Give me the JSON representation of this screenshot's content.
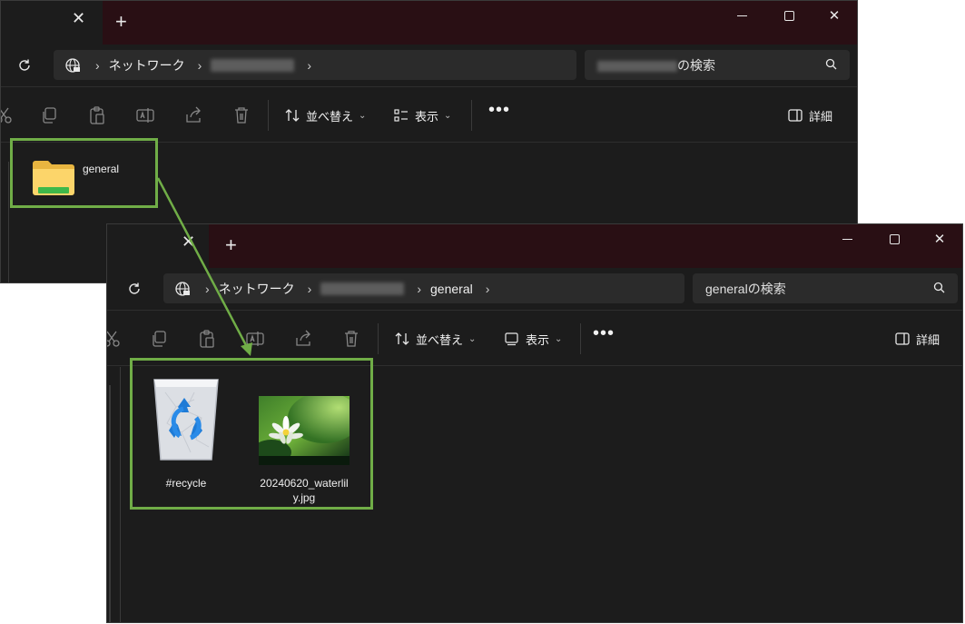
{
  "window1": {
    "title_close": "✕",
    "new_tab": "+",
    "breadcrumb": {
      "root": "ネットワーク"
    },
    "search": {
      "suffix": "の検索"
    },
    "toolbar": {
      "sort_label": "並べ替え",
      "view_label": "表示",
      "more_label": "•••",
      "details_label": "詳細"
    },
    "items": [
      {
        "name": "general"
      }
    ]
  },
  "window2": {
    "title_close": "✕",
    "new_tab": "+",
    "breadcrumb": {
      "root": "ネットワーク",
      "folder": "general"
    },
    "search": {
      "placeholder": "generalの検索"
    },
    "toolbar": {
      "sort_label": "並べ替え",
      "view_label": "表示",
      "more_label": "•••",
      "details_label": "詳細"
    },
    "items": [
      {
        "name": "#recycle"
      },
      {
        "name": "20240620_waterlil\ny.jpg"
      }
    ]
  },
  "colors": {
    "highlight": "#70ad47",
    "titlebar": "#290f14",
    "window_bg": "#1c1c1c"
  },
  "icons": [
    "refresh-icon",
    "network-globe-icon",
    "cut-icon",
    "copy-icon",
    "paste-icon",
    "rename-icon",
    "share-icon",
    "delete-icon",
    "sort-icon",
    "view-icon",
    "details-pane-icon",
    "search-icon",
    "folder-icon",
    "recycle-bin-icon",
    "image-thumbnail"
  ]
}
